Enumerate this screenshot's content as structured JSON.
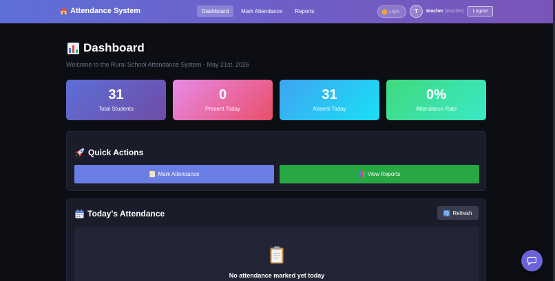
{
  "navbar": {
    "brand": "Attendance System",
    "links": [
      {
        "label": "Dashboard",
        "active": true
      },
      {
        "label": "Mark Attendance",
        "active": false
      },
      {
        "label": "Reports",
        "active": false
      }
    ],
    "theme_label": "Light",
    "avatar_initial": "T",
    "username": "teacher",
    "role": "(teacher)",
    "logout_label": "Logout"
  },
  "page": {
    "title": "Dashboard",
    "subtitle": "Welcome to the Rural School Attendance System - May 21st, 2026"
  },
  "stats": [
    {
      "value": "31",
      "label": "Total Students"
    },
    {
      "value": "0",
      "label": "Present Today"
    },
    {
      "value": "31",
      "label": "Absent Today"
    },
    {
      "value": "0%",
      "label": "Attendance Rate"
    }
  ],
  "quick_actions": {
    "title": "Quick Actions",
    "mark_label": "Mark Attendance",
    "view_label": "View Reports"
  },
  "todays_attendance": {
    "title": "Today's Attendance",
    "refresh_label": "Refresh",
    "empty_message": "No attendance marked yet today"
  },
  "colors": {
    "navbar_start": "#5f6fd9",
    "navbar_end": "#7a55b8",
    "mark_button": "#6b7ee6",
    "view_button": "#28a745",
    "card_bg": "#1a1c2a",
    "chat_fab": "#6c63d9"
  },
  "icons": {
    "brand": "house-icon",
    "title": "bar-chart-icon",
    "quick_actions": "rocket-icon",
    "todays_attendance": "calendar-icon",
    "refresh": "refresh-icon",
    "empty": "clipboard-icon",
    "chat": "chat-bubble-icon"
  }
}
